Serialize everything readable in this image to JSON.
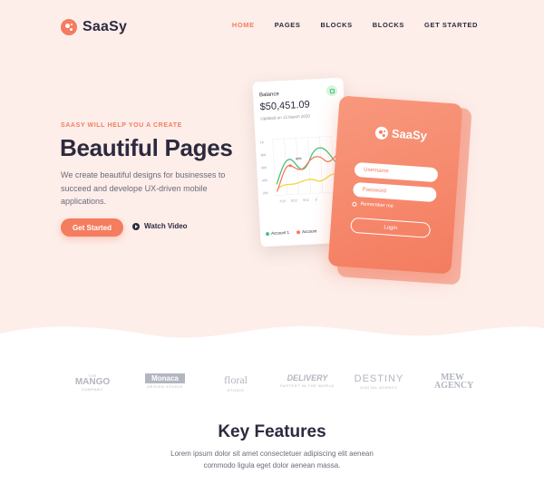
{
  "brand": {
    "name": "SaaSy",
    "accent": "#f47c5f",
    "hero_bg": "#fdeeea",
    "dark": "#2d2a3e"
  },
  "nav": {
    "items": [
      {
        "label": "HOME",
        "active": true
      },
      {
        "label": "PAGES",
        "active": false
      },
      {
        "label": "BLOCKS",
        "active": false
      },
      {
        "label": "BLOCKS",
        "active": false
      },
      {
        "label": "GET STARTED",
        "active": false
      }
    ]
  },
  "hero": {
    "eyebrow": "SAASY WILL HELP YOU A CREATE",
    "headline": "Beautiful Pages",
    "lede": "We create beautiful designs for businesses to succeed and develope UX-driven mobile applications.",
    "cta_label": "Get Started",
    "video_label": "Watch Video",
    "video_icon": "play-icon"
  },
  "balance_card": {
    "label": "Balance",
    "value": "$50,451.09",
    "updated": "Updated on 13 March 2020",
    "y_ticks": [
      "1K",
      "800",
      "600",
      "400",
      "200"
    ],
    "x_ticks": [
      "7/12",
      "8/12",
      "9/12",
      "1/"
    ],
    "annotation": "40%",
    "legend": [
      {
        "label": "Account 1",
        "color": "#4cc27a"
      },
      {
        "label": "Account",
        "color": "#f47c5f"
      }
    ]
  },
  "login_card": {
    "brand": "SaaSy",
    "username_placeholder": "Username",
    "password_placeholder": "Password",
    "remember_label": "Remember me",
    "login_label": "Login"
  },
  "partners": [
    {
      "name": "MANGO",
      "prefix": "THE",
      "sub": "COMPANY"
    },
    {
      "name": "Monaca",
      "prefix": "",
      "sub": "DESIGN STUDIO"
    },
    {
      "name": "floral",
      "prefix": "",
      "sub": "STUDIO"
    },
    {
      "name": "DELIVERY",
      "prefix": "",
      "sub": "FASTEST IN THE WORLD"
    },
    {
      "name": "DESTINY",
      "prefix": "",
      "sub": "DIGITAL AGENCY"
    },
    {
      "name": "MEW AGENCY",
      "prefix": "",
      "sub": ""
    }
  ],
  "features": {
    "title": "Key Features",
    "text": "Lorem ipsum dolor sit amet consectetuer adipiscing elit aenean commodo ligula eget dolor aenean massa."
  }
}
